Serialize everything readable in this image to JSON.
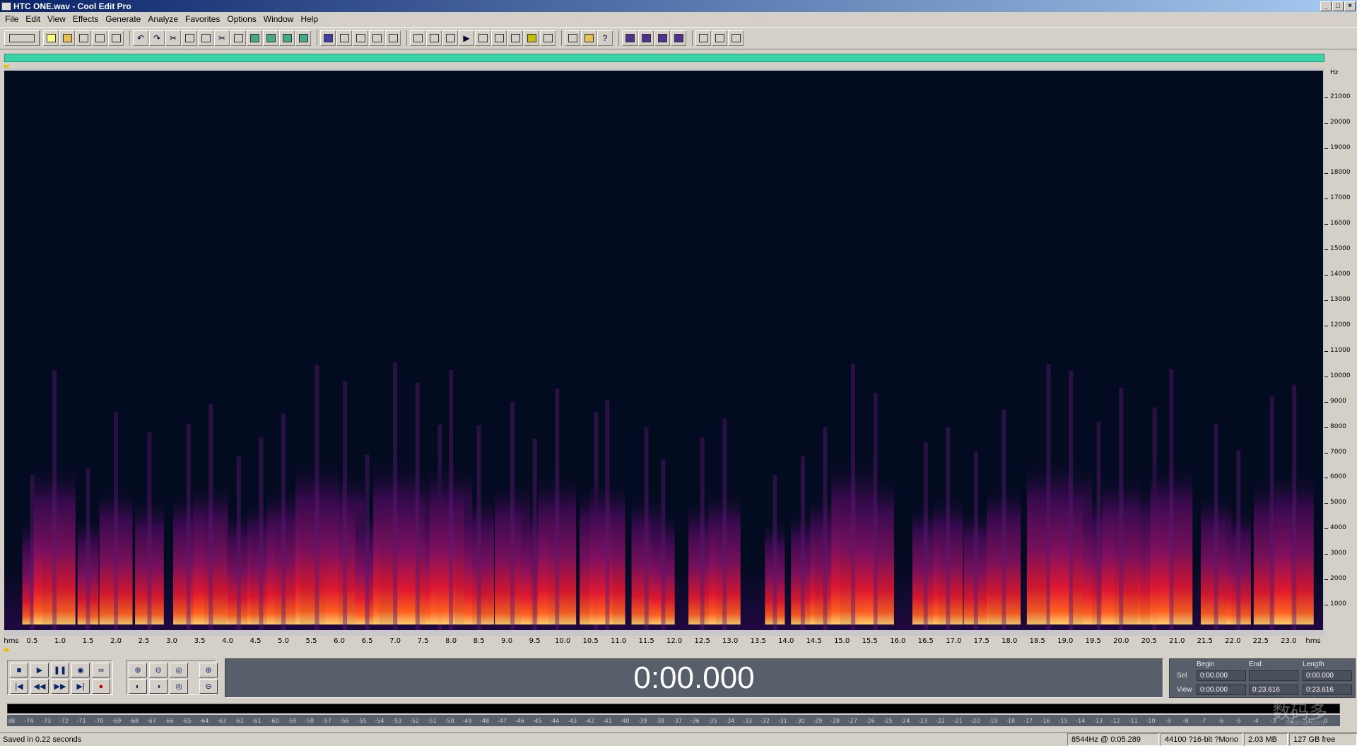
{
  "window": {
    "title": "HTC ONE.wav - Cool Edit Pro",
    "min": "_",
    "max": "□",
    "close": "×"
  },
  "menu": [
    "File",
    "Edit",
    "View",
    "Effects",
    "Generate",
    "Analyze",
    "Favorites",
    "Options",
    "Window",
    "Help"
  ],
  "freq_axis": {
    "unit": "Hz",
    "labels": [
      "21000",
      "20000",
      "19000",
      "18000",
      "17000",
      "16000",
      "15000",
      "14000",
      "13000",
      "12000",
      "11000",
      "10000",
      "9000",
      "8000",
      "7000",
      "6000",
      "5000",
      "4000",
      "3000",
      "2000",
      "1000"
    ]
  },
  "time_axis": {
    "start_label": "hms",
    "end_label": "hms",
    "labels": [
      "0.5",
      "1.0",
      "1.5",
      "2.0",
      "2.5",
      "3.0",
      "3.5",
      "4.0",
      "4.5",
      "5.0",
      "5.5",
      "6.0",
      "6.5",
      "7.0",
      "7.5",
      "8.0",
      "8.5",
      "9.0",
      "9.5",
      "10.0",
      "10.5",
      "11.0",
      "11.5",
      "12.0",
      "12.5",
      "13.0",
      "13.5",
      "14.0",
      "14.5",
      "15.0",
      "15.5",
      "16.0",
      "16.5",
      "17.0",
      "17.5",
      "18.0",
      "18.5",
      "19.0",
      "19.5",
      "20.0",
      "20.5",
      "21.0",
      "21.5",
      "22.0",
      "22.5",
      "23.0"
    ]
  },
  "display": {
    "time": "0:00.000"
  },
  "selection": {
    "headers": {
      "begin": "Begin",
      "end": "End",
      "length": "Length"
    },
    "sel": {
      "label": "Sel",
      "begin": "0:00.000",
      "end": "",
      "length": "0:00.000"
    },
    "view": {
      "label": "View",
      "begin": "0:00.000",
      "end": "0:23.616",
      "length": "0:23.616"
    }
  },
  "meter": {
    "labels": [
      "dB",
      "-74",
      "-73",
      "-72",
      "-71",
      "-70",
      "-69",
      "-68",
      "-67",
      "-66",
      "-65",
      "-64",
      "-63",
      "-62",
      "-61",
      "-60",
      "-59",
      "-58",
      "-57",
      "-56",
      "-55",
      "-54",
      "-53",
      "-52",
      "-51",
      "-50",
      "-49",
      "-48",
      "-47",
      "-46",
      "-45",
      "-44",
      "-43",
      "-42",
      "-41",
      "-40",
      "-39",
      "-38",
      "-37",
      "-36",
      "-35",
      "-34",
      "-33",
      "-32",
      "-31",
      "-30",
      "-29",
      "-28",
      "-27",
      "-26",
      "-25",
      "-24",
      "-23",
      "-22",
      "-21",
      "-20",
      "-19",
      "-18",
      "-17",
      "-16",
      "-15",
      "-14",
      "-13",
      "-12",
      "-11",
      "-10",
      "-9",
      "-8",
      "-7",
      "-6",
      "-5",
      "-4",
      "-3",
      "-2",
      "-1",
      "0"
    ]
  },
  "status": {
    "message": "Saved in 0.22 seconds",
    "cursor": "8544Hz @   0:05.289",
    "format": "44100 ?16-bit ?Mono",
    "size": "2.03 MB",
    "free": "127 GB free"
  },
  "watermark": {
    "main": "数码多",
    "sub": "Soomal.com"
  },
  "spectrogram": {
    "duration_s": 23.616,
    "max_hz": 22050,
    "bursts_s": [
      0.5,
      0.9,
      1.5,
      2.0,
      2.6,
      3.3,
      3.7,
      4.2,
      4.6,
      5.0,
      5.6,
      6.1,
      6.5,
      7.0,
      7.4,
      7.8,
      8.0,
      8.5,
      9.1,
      9.5,
      9.9,
      10.6,
      10.8,
      11.5,
      11.8,
      12.5,
      12.9,
      13.8,
      14.3,
      14.7,
      15.2,
      15.6,
      16.5,
      16.9,
      17.4,
      17.9,
      18.7,
      19.1,
      19.6,
      20.0,
      20.6,
      20.9,
      21.7,
      22.1,
      22.7,
      23.1
    ]
  }
}
